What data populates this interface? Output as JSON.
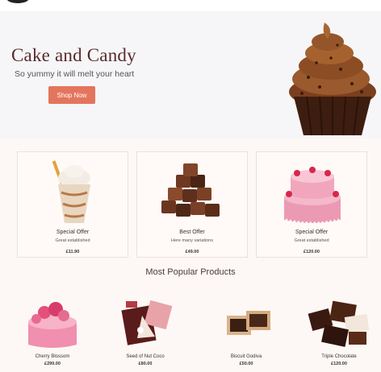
{
  "hero": {
    "title": "Cake and Candy",
    "subtitle": "So yummy it will melt your heart",
    "cta_label": "Shop Now"
  },
  "offers": [
    {
      "title": "Special Offer",
      "subtitle": "Great established",
      "price": "£11.90",
      "icon": "frappe-drink-icon"
    },
    {
      "title": "Best Offer",
      "subtitle": "Here many variations",
      "price": "£49.00",
      "icon": "chocolate-pile-icon"
    },
    {
      "title": "Special Offer",
      "subtitle": "Great established",
      "price": "£120.00",
      "icon": "pink-cake-icon"
    }
  ],
  "popular": {
    "heading": "Most Popular Products",
    "items": [
      {
        "name": "Cherry Blossom",
        "price": "£290.00",
        "icon": "flower-cake-icon"
      },
      {
        "name": "Seed of Nut Coco",
        "price": "£80.00",
        "icon": "chocolate-bar-icon"
      },
      {
        "name": "Biscuit Godiva",
        "price": "£50.00",
        "icon": "biscuit-icon"
      },
      {
        "name": "Triple Chocolate",
        "price": "£120.00",
        "icon": "chocolate-chunks-icon"
      }
    ]
  },
  "colors": {
    "accent": "#e4755d",
    "title": "#5a2a2a",
    "hero_bg": "#f6f6f8",
    "section_bg": "#fdf8f6"
  }
}
